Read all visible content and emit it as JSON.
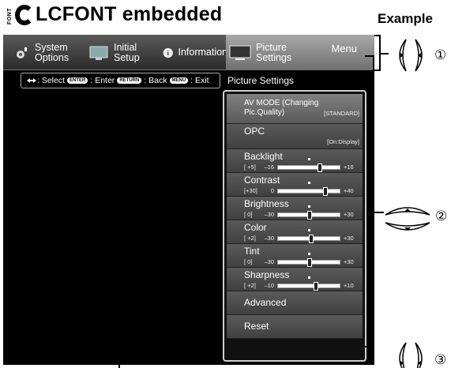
{
  "header": {
    "font_badge": "FONT",
    "title": "LCFONT embedded",
    "example_label": "Example"
  },
  "menubar": {
    "tabs": [
      {
        "label": "System Options",
        "icon": "gear-icon"
      },
      {
        "label": "Initial Setup",
        "icon": "setup-icon"
      },
      {
        "label": "Information",
        "icon": "info-icon"
      },
      {
        "label": "Picture Settings",
        "icon": "monitor-icon"
      }
    ],
    "menu_label": "Menu"
  },
  "help_bar": {
    "select": ": Select",
    "enter_key": "ENTER",
    "enter": ": Enter",
    "back_key": "RETURN",
    "back": ": Back",
    "menu_key": "MENU",
    "exit": ": Exit"
  },
  "picture_settings_label": "Picture Settings",
  "items": {
    "av_mode": {
      "label": "AV MODE (Changing Pic.Quality)",
      "value": "[STANDARD]"
    },
    "opc": {
      "label": "OPC",
      "value": "[On:Display]"
    },
    "backlight": {
      "label": "Backlight",
      "current": "[ +5]",
      "min": "–16",
      "max": "+16",
      "level": 0.66
    },
    "contrast": {
      "label": "Contrast",
      "current": "[+30]",
      "min": "0",
      "max": "+40",
      "level": 0.75
    },
    "brightness": {
      "label": "Brightness",
      "current": "[  0]",
      "min": "–30",
      "max": "+30",
      "level": 0.5
    },
    "color": {
      "label": "Color",
      "current": "[ +2]",
      "min": "–30",
      "max": "+30",
      "level": 0.53
    },
    "tint": {
      "label": "Tint",
      "current": "[  0]",
      "min": "–30",
      "max": "+30",
      "level": 0.5
    },
    "sharpness": {
      "label": "Sharpness",
      "current": "[ +2]",
      "min": "–10",
      "max": "+10",
      "level": 0.6
    },
    "advanced": {
      "label": "Advanced"
    },
    "reset": {
      "label": "Reset"
    }
  },
  "callouts": [
    "①",
    "②",
    "③"
  ]
}
